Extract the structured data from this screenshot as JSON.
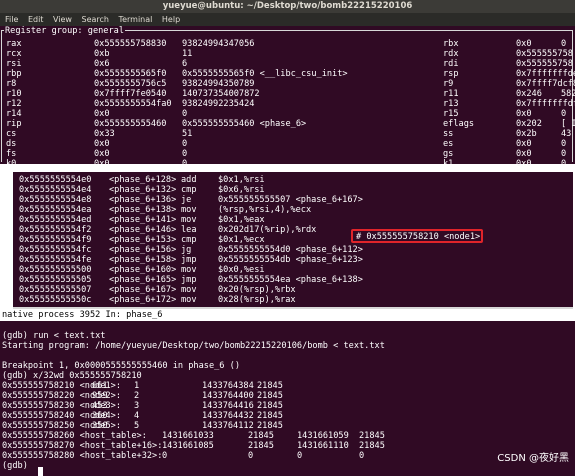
{
  "window": {
    "title": "yueyue@ubuntu: ~/Desktop/two/bomb22215220106",
    "menu": [
      "File",
      "Edit",
      "View",
      "Search",
      "Terminal",
      "Help"
    ]
  },
  "registers": {
    "group_title": "Register group: general",
    "left": [
      {
        "name": "rax",
        "hex": "0x555555758830",
        "dec": "93824994347056"
      },
      {
        "name": "rcx",
        "hex": "0xb",
        "dec": "11"
      },
      {
        "name": "rsi",
        "hex": "0x6",
        "dec": "6"
      },
      {
        "name": "rbp",
        "hex": "0x5555555565f0",
        "dec": "0x5555555565f0 <__libc_csu_init>"
      },
      {
        "name": "r8",
        "hex": "0x5555555756c5",
        "dec": "93824994350789"
      },
      {
        "name": "r10",
        "hex": "0x7ffff7fe0540",
        "dec": "140737354007872"
      },
      {
        "name": "r12",
        "hex": "0x5555555554fa0",
        "dec": "93824992235424"
      },
      {
        "name": "r14",
        "hex": "0x0",
        "dec": "0"
      },
      {
        "name": "rip",
        "hex": "0x555555555460",
        "dec": "0x555555555460 <phase_6>"
      },
      {
        "name": "cs",
        "hex": "0x33",
        "dec": "51"
      },
      {
        "name": "ds",
        "hex": "0x0",
        "dec": "0"
      },
      {
        "name": "fs",
        "hex": "0x0",
        "dec": "0"
      },
      {
        "name": "k0",
        "hex": "0x0",
        "dec": "0"
      }
    ],
    "right": [
      {
        "name": "rbx",
        "hex": "0x0",
        "dec": "0"
      },
      {
        "name": "rdx",
        "hex": "0x555555758",
        "dec": ""
      },
      {
        "name": "rdi",
        "hex": "0x555555758",
        "dec": ""
      },
      {
        "name": "rsp",
        "hex": "0x7fffffffde",
        "dec": ""
      },
      {
        "name": "r9",
        "hex": "0x7ffff7dcf8",
        "dec": ""
      },
      {
        "name": "r11",
        "hex": "0x246",
        "dec": "582"
      },
      {
        "name": "r13",
        "hex": "0x7fffffffdf",
        "dec": ""
      },
      {
        "name": "r15",
        "hex": "0x0",
        "dec": "0"
      },
      {
        "name": "eflags",
        "hex": "0x202",
        "dec": "[ I"
      },
      {
        "name": "ss",
        "hex": "0x2b",
        "dec": "43"
      },
      {
        "name": "es",
        "hex": "0x0",
        "dec": "0"
      },
      {
        "name": "gs",
        "hex": "0x0",
        "dec": "0"
      },
      {
        "name": "k1",
        "hex": "0x0",
        "dec": "0"
      }
    ]
  },
  "disassembly": [
    {
      "addr": "0x5555555554e0",
      "func": "<phase_6+128>",
      "mnem": "add",
      "ops": "$0x1,%rsi"
    },
    {
      "addr": "0x5555555554e4",
      "func": "<phase_6+132>",
      "mnem": "cmp",
      "ops": "$0x6,%rsi"
    },
    {
      "addr": "0x5555555554e8",
      "func": "<phase_6+136>",
      "mnem": "je",
      "ops": "0x555555555507 <phase_6+167>"
    },
    {
      "addr": "0x5555555554ea",
      "func": "<phase_6+138>",
      "mnem": "mov",
      "ops": "(%rsp,%rsi,4),%ecx"
    },
    {
      "addr": "0x5555555554ed",
      "func": "<phase_6+141>",
      "mnem": "mov",
      "ops": "$0x1,%eax"
    },
    {
      "addr": "0x5555555554f2",
      "func": "<phase_6+146>",
      "mnem": "lea",
      "ops": "0x202d17(%rip),%rdx"
    },
    {
      "addr": "0x5555555554f9",
      "func": "<phase_6+153>",
      "mnem": "cmp",
      "ops": "$0x1,%ecx"
    },
    {
      "addr": "0x5555555554fc",
      "func": "<phase_6+156>",
      "mnem": "jg",
      "ops": "0x5555555554d0 <phase_6+112>"
    },
    {
      "addr": "0x5555555554fe",
      "func": "<phase_6+158>",
      "mnem": "jmp",
      "ops": "0x5555555554db <phase_6+123>"
    },
    {
      "addr": "0x555555555500",
      "func": "<phase_6+160>",
      "mnem": "mov",
      "ops": "$0x0,%esi"
    },
    {
      "addr": "0x555555555505",
      "func": "<phase_6+165>",
      "mnem": "jmp",
      "ops": "0x5555555554ea <phase_6+138>"
    },
    {
      "addr": "0x555555555507",
      "func": "<phase_6+167>",
      "mnem": "mov",
      "ops": "0x20(%rsp),%rbx"
    },
    {
      "addr": "0x55555555550c",
      "func": "<phase_6+172>",
      "mnem": "mov",
      "ops": "0x28(%rsp),%rax"
    }
  ],
  "highlight_comment": "# 0x555555758210 <node1>",
  "status_bar": "native process 3952 In: phase_6",
  "console": {
    "lines": [
      "(gdb) run < text.txt",
      "Starting program: /home/yueyue/Desktop/two/bomb22215220106/bomb < text.txt",
      "",
      "Breakpoint 1, 0x0000555555555460 in phase_6 ()",
      "(gdb) x/32wd 0x555555758210"
    ],
    "memory": [
      {
        "addr": "0x555555758210 <node1>:",
        "v": [
          "661",
          "1",
          "1433764384",
          "21845"
        ]
      },
      {
        "addr": "0x555555758220 <node2>:",
        "v": [
          "959",
          "2",
          "1433764400",
          "21845"
        ]
      },
      {
        "addr": "0x555555758230 <node3>:",
        "v": [
          "453",
          "3",
          "1433764416",
          "21845"
        ]
      },
      {
        "addr": "0x555555758240 <node4>:",
        "v": [
          "360",
          "4",
          "1433764432",
          "21845"
        ]
      },
      {
        "addr": "0x555555758250 <node5>:",
        "v": [
          "350",
          "5",
          "1433764112",
          "21845"
        ]
      },
      {
        "addr": "0x555555758260 <host_table>:",
        "v": [
          "1431661033",
          "21845",
          "1431661059",
          "21845"
        ]
      },
      {
        "addr": "0x555555758270 <host_table+16>:",
        "v": [
          "1431661085",
          "21845",
          "1431661110",
          "21845"
        ]
      },
      {
        "addr": "0x555555758280 <host_table+32>:",
        "v": [
          "0",
          "0",
          "0",
          "0"
        ]
      }
    ],
    "prompt": "(gdb)"
  },
  "watermark": "CSDN @夜好黑"
}
